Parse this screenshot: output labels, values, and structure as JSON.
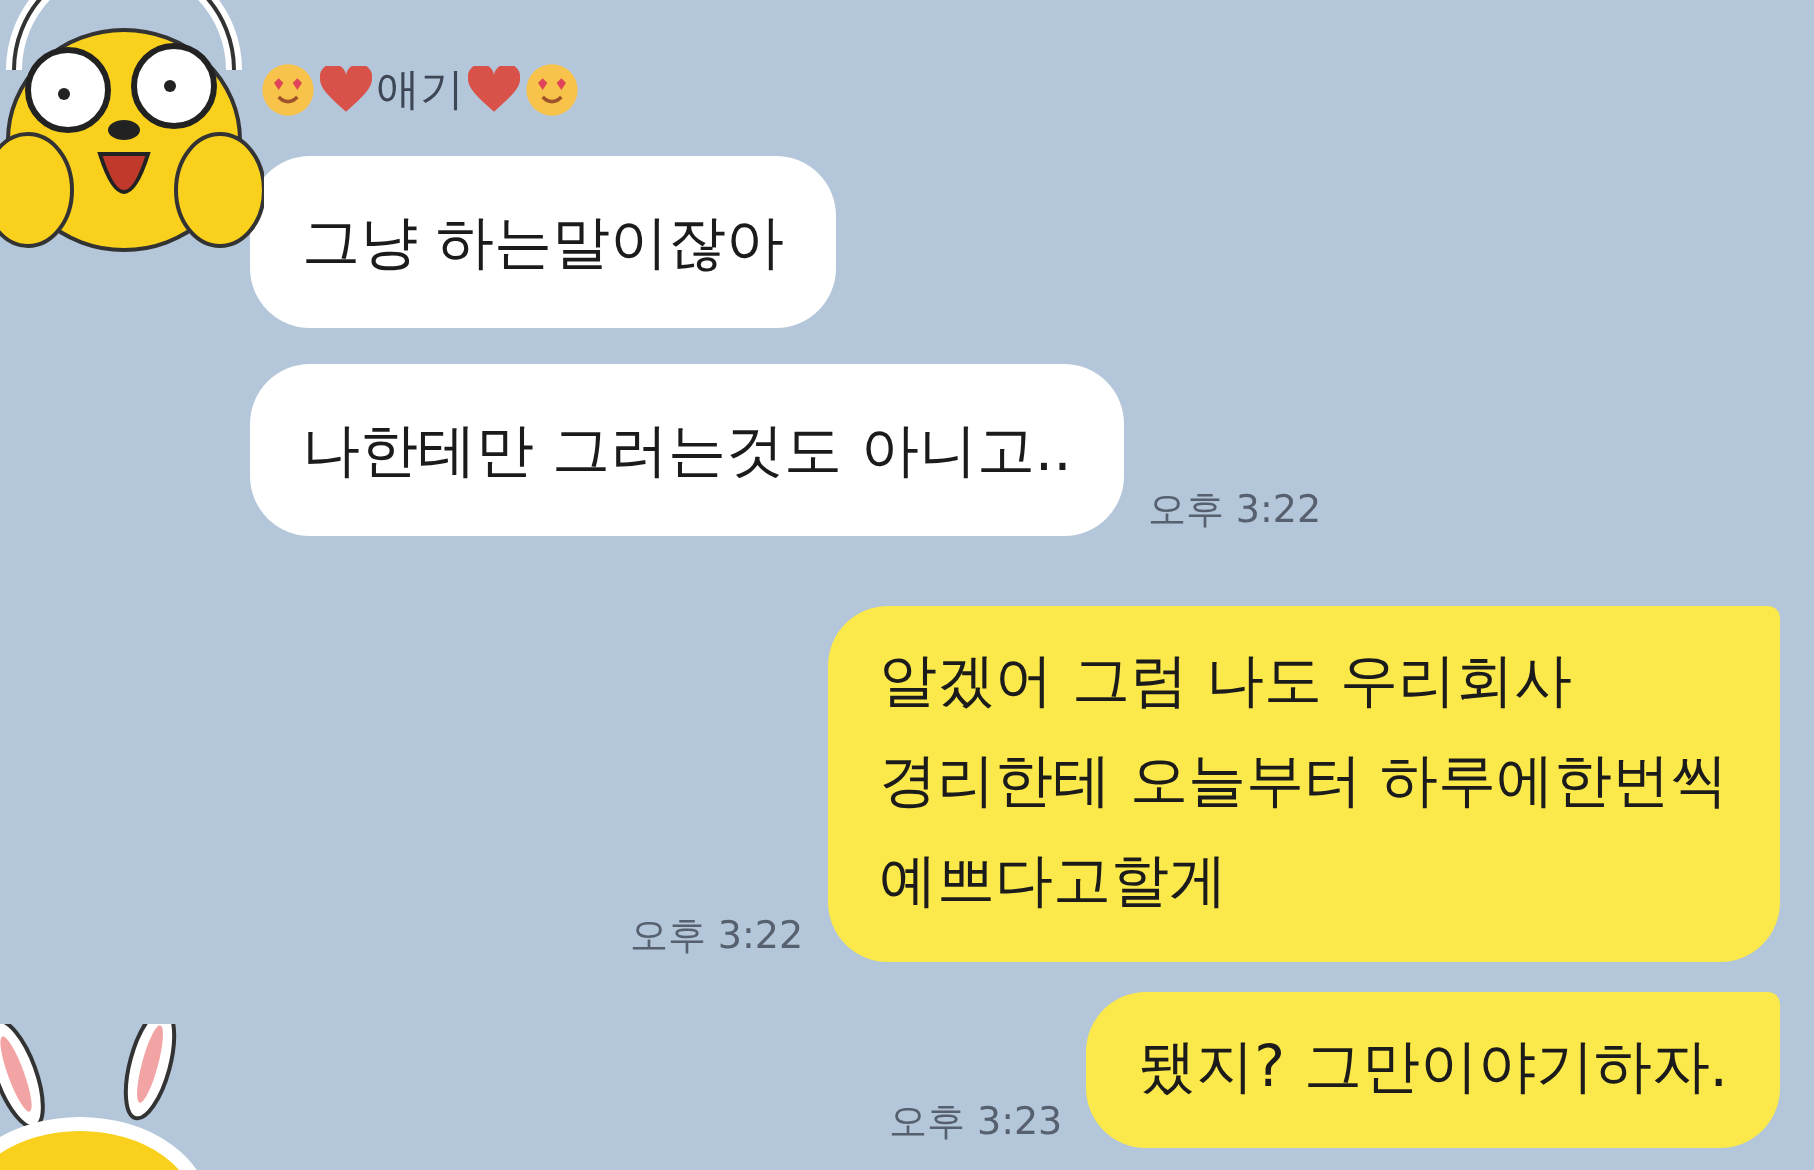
{
  "sender": {
    "name": "애기"
  },
  "messages": [
    {
      "kind": "incoming",
      "lines": [
        "그냥 하는말이잖아"
      ]
    },
    {
      "kind": "incoming",
      "lines": [
        "나한테만 그러는것도 아니고.."
      ],
      "time": "오후 3:22"
    },
    {
      "kind": "outgoing",
      "lines": [
        "알겠어 그럼 나도 우리회사",
        "경리한테 오늘부터 하루에한번씩",
        "예쁘다고할게"
      ],
      "time": "오후 3:22"
    },
    {
      "kind": "outgoing",
      "lines": [
        "됐지? 그만이야기하자."
      ],
      "time": "오후 3:23"
    }
  ]
}
